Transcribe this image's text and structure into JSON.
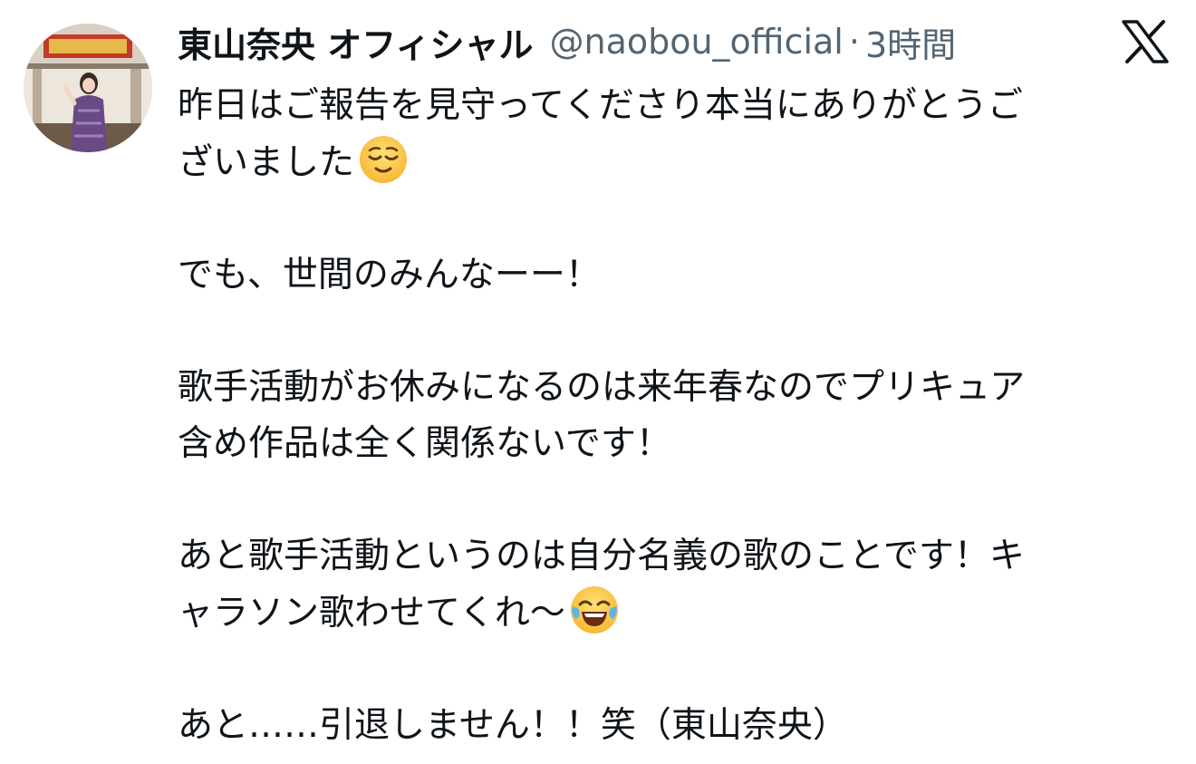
{
  "author": {
    "display_name": "東山奈央 オフィシャル",
    "handle": "@naobou_official",
    "separator": "·",
    "timestamp": "3時間",
    "avatar_icon": "profile-photo"
  },
  "platform": {
    "logo_icon": "x-logo-icon"
  },
  "tweet": {
    "paragraphs": [
      {
        "lines": [
          "昨日はご報告を見守ってくださり本当にありがとうご",
          "ざいました"
        ],
        "emoji": "relieved-face-emoji"
      },
      {
        "lines": [
          "でも、世間のみんなーー！"
        ]
      },
      {
        "lines": [
          "歌手活動がお休みになるのは来年春なのでプリキュア",
          "含め作品は全く関係ないです！"
        ]
      },
      {
        "lines": [
          "あと歌手活動というのは自分名義の歌のことです！キ",
          "ャラソン歌わせてくれ〜"
        ],
        "emoji": "tears-of-joy-emoji"
      },
      {
        "lines": [
          "あと……引退しません！！笑（東山奈央）"
        ]
      }
    ]
  },
  "colors": {
    "text": "#0f1419",
    "secondary": "#536471",
    "background": "#ffffff"
  }
}
